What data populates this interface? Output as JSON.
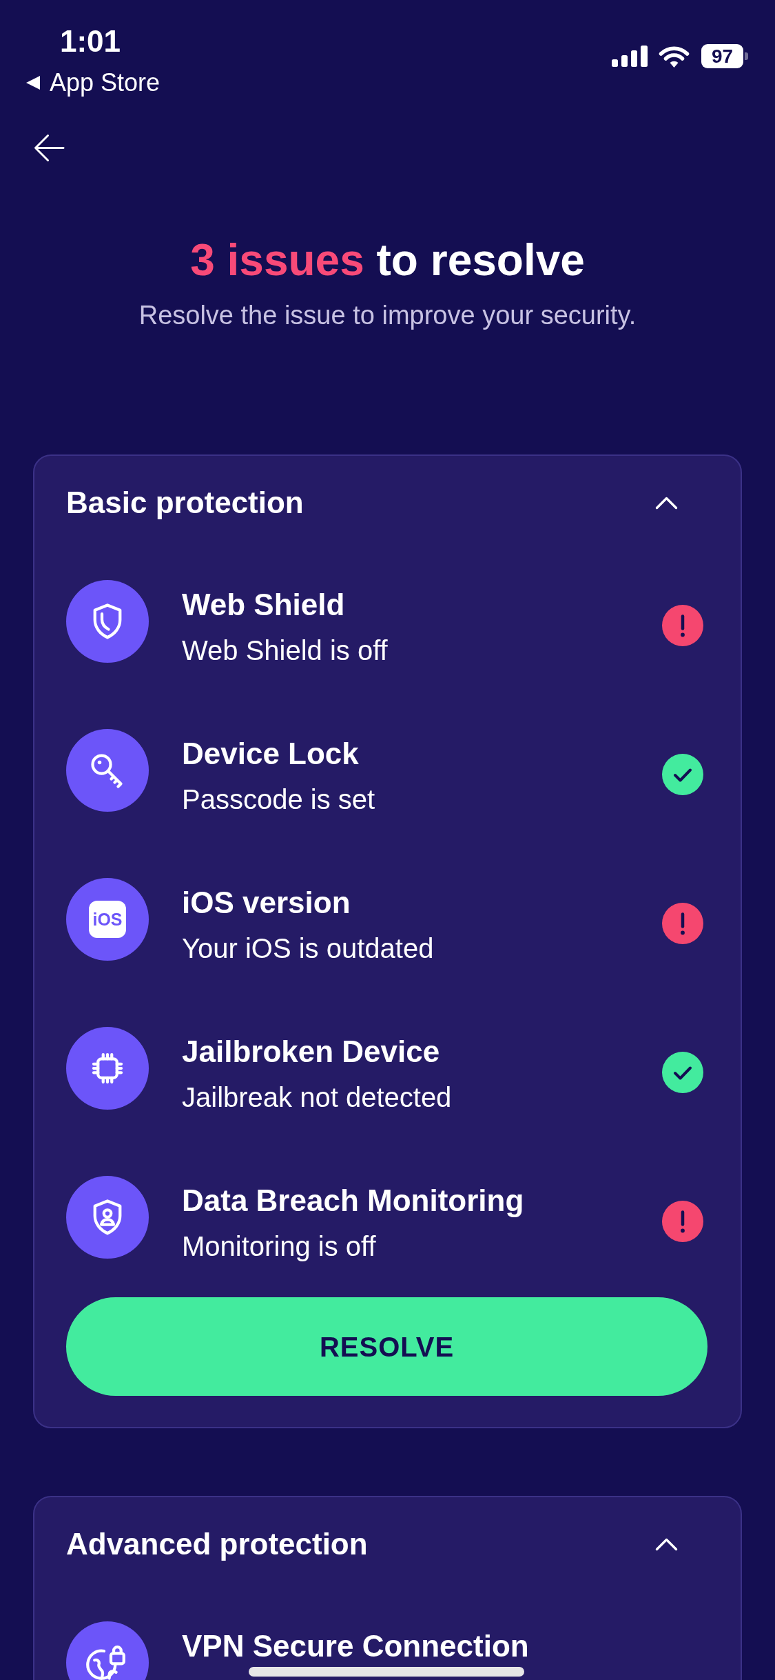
{
  "status_bar": {
    "time": "1:01",
    "back_label": "App Store",
    "battery": "97"
  },
  "header": {
    "title_accent": "3 issues",
    "title_rest": "to resolve",
    "subtitle": "Resolve the issue to improve your security."
  },
  "sections": [
    {
      "title": "Basic protection",
      "expanded": true,
      "items": [
        {
          "title": "Web Shield",
          "subtitle": "Web Shield is off",
          "resolved": false
        },
        {
          "title": "Device Lock",
          "subtitle": "Passcode is set",
          "resolved": true
        },
        {
          "icon_text": "iOS",
          "title": "iOS version",
          "subtitle": "Your iOS is outdated",
          "resolved": false
        },
        {
          "title": "Jailbroken Device",
          "subtitle": "Jailbreak not detected",
          "resolved": true
        },
        {
          "title": "Data Breach Monitoring",
          "subtitle": "Monitoring is off",
          "resolved": false
        }
      ],
      "button": "RESOLVE"
    },
    {
      "title": "Advanced protection",
      "expanded": true,
      "items": [
        {
          "title": "VPN Secure Connection"
        }
      ]
    }
  ]
}
